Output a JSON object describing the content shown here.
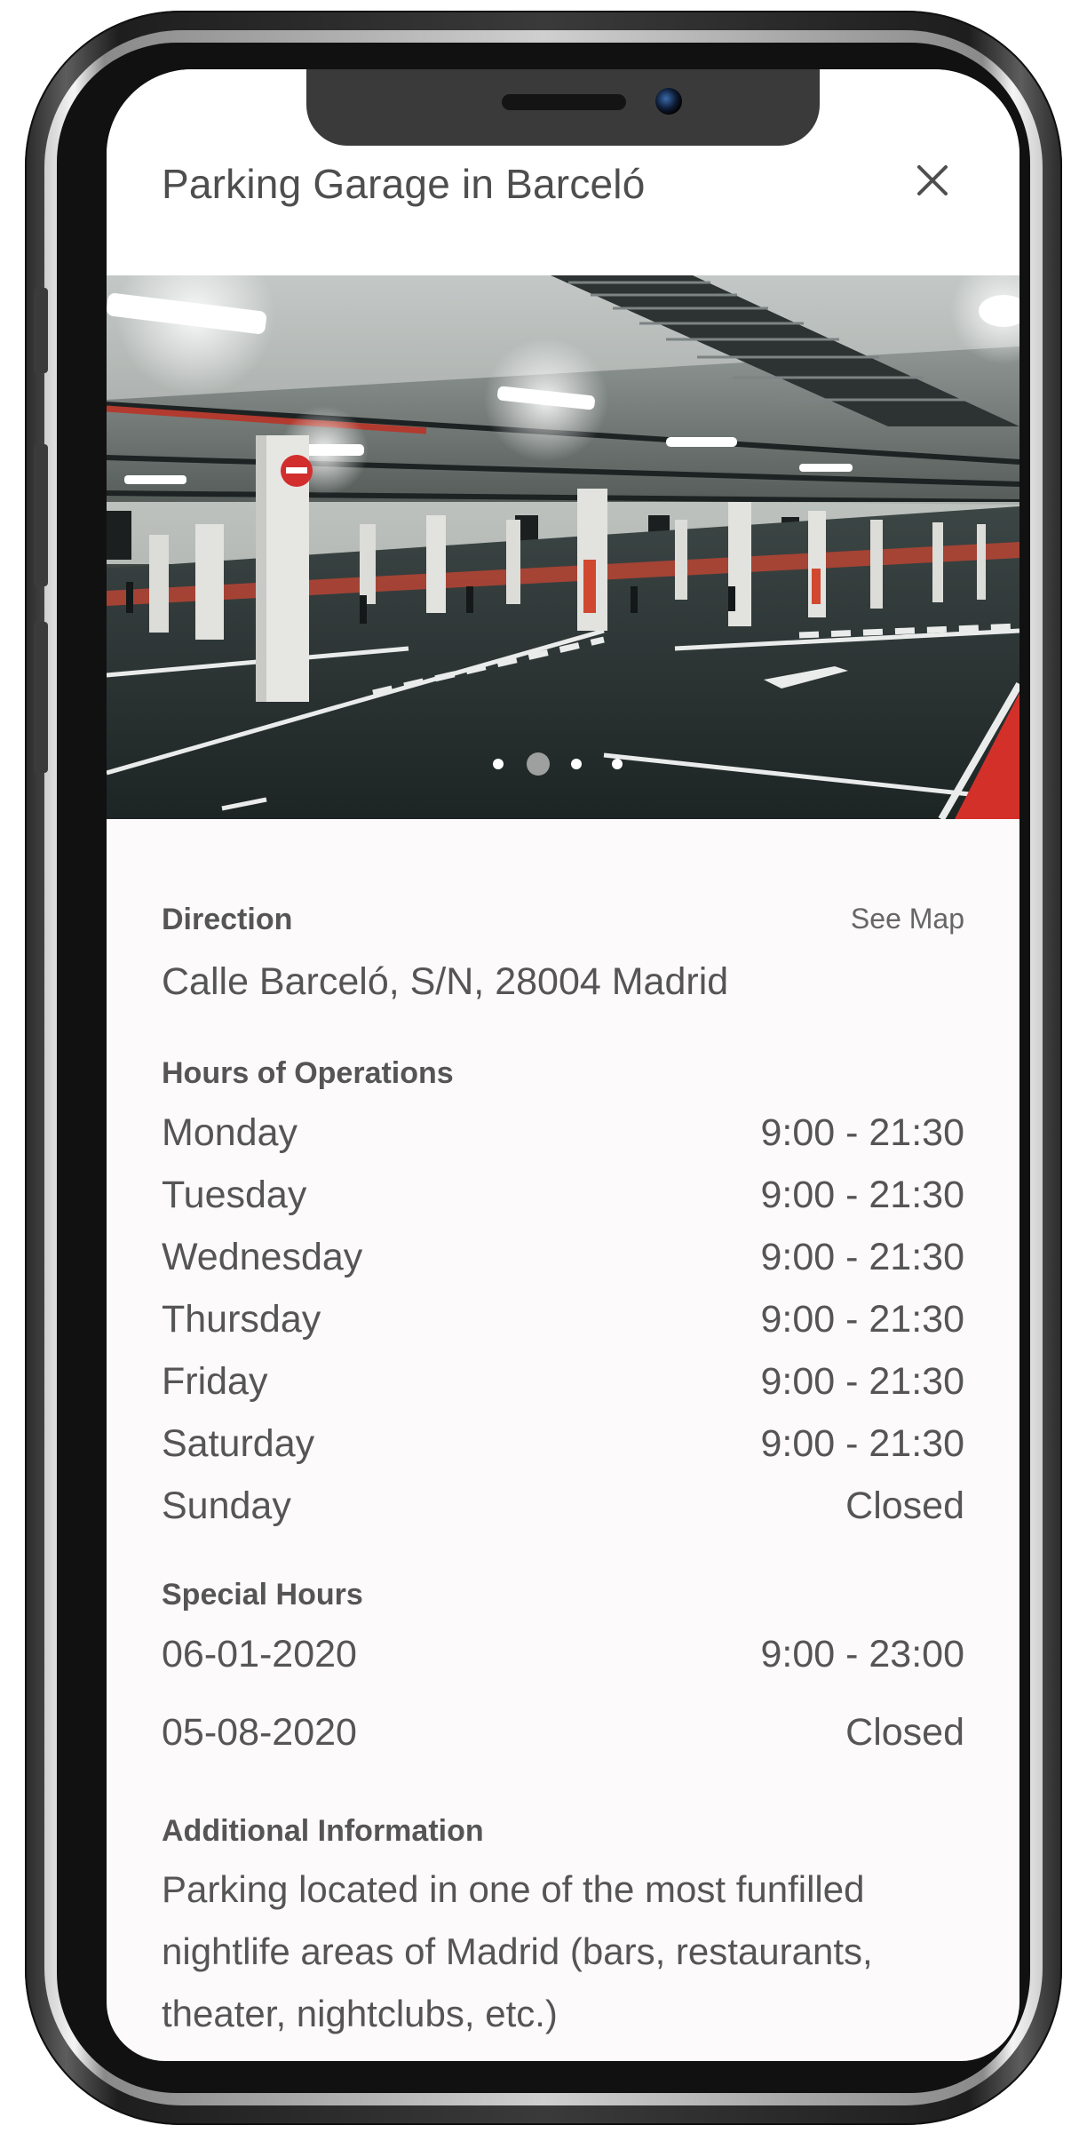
{
  "header": {
    "title": "Parking Garage in Barceló"
  },
  "gallery": {
    "dot_count": 4,
    "active_index": 1
  },
  "direction": {
    "label": "Direction",
    "map_link": "See Map",
    "address": "Calle Barceló, S/N, 28004 Madrid"
  },
  "hours": {
    "label": "Hours of Operations",
    "rows": [
      {
        "day": "Monday",
        "hours": "9:00 - 21:30"
      },
      {
        "day": "Tuesday",
        "hours": "9:00 - 21:30"
      },
      {
        "day": "Wednesday",
        "hours": "9:00 - 21:30"
      },
      {
        "day": "Thursday",
        "hours": "9:00 - 21:30"
      },
      {
        "day": "Friday",
        "hours": "9:00 - 21:30"
      },
      {
        "day": "Saturday",
        "hours": "9:00 - 21:30"
      },
      {
        "day": "Sunday",
        "hours": "Closed"
      }
    ]
  },
  "special_hours": {
    "label": "Special Hours",
    "rows": [
      {
        "date": "06-01-2020",
        "hours": "9:00 - 23:00"
      },
      {
        "date": "05-08-2020",
        "hours": "Closed"
      }
    ]
  },
  "additional": {
    "label": "Additional Information",
    "lines": [
      "Parking located in one of the most funfilled",
      "nightlife areas of Madrid (bars, restaurants,",
      "theater, nightclubs, etc.)"
    ]
  },
  "colors": {
    "screen_bg": "#fcfafb",
    "text": "#555555",
    "frame": "#2e2e2e"
  }
}
